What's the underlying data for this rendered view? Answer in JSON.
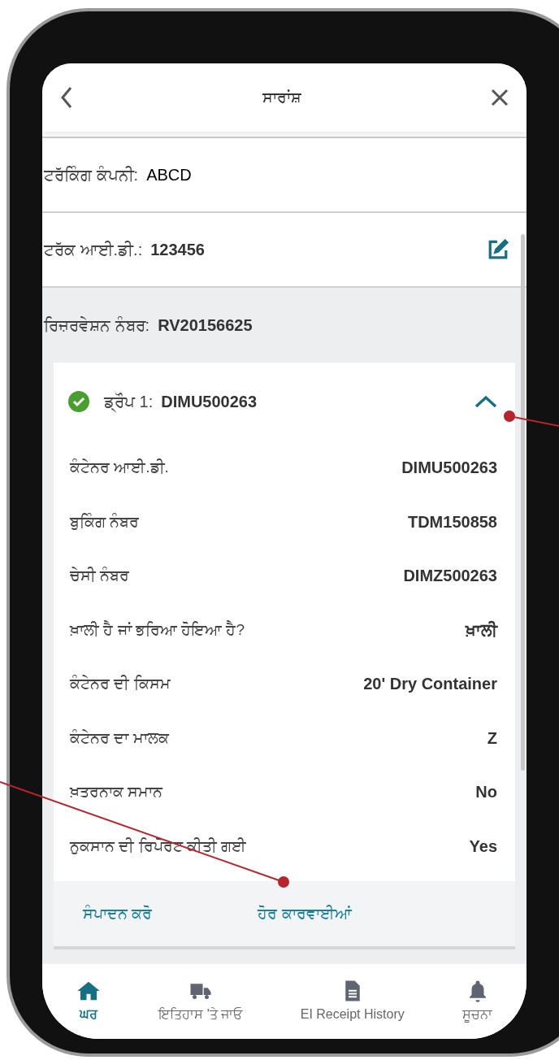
{
  "header": {
    "title": "ਸਾਰਾਂਸ਼"
  },
  "summary_rows": [
    {
      "label": "ਟਰੱਕਿੰਗ ਕੰਪਨੀ:",
      "value": "ABCD",
      "editable": false,
      "shaded": false
    },
    {
      "label": "ਟਰੱਕ ਆਈ.ਡੀ.:",
      "value": "123456",
      "editable": true,
      "shaded": false
    },
    {
      "label": "ਰਿਜ਼ਰਵੇਸ਼ਨ ਨੰਬਰ:",
      "value": "RV20156625",
      "editable": false,
      "shaded": true
    }
  ],
  "trip_card": {
    "label": "ਡ੍ਰੌਪ 1:",
    "value": "DIMU500263",
    "completed": true,
    "expanded": true,
    "details": [
      {
        "label": "ਕੰਟੇਨਰ ਆਈ.ਡੀ.",
        "value": "DIMU500263"
      },
      {
        "label": "ਬੁਕਿੰਗ ਨੰਬਰ",
        "value": "TDM150858"
      },
      {
        "label": "ਚੇਸੀ ਨੰਬਰ",
        "value": "DIMZ500263"
      },
      {
        "label": "ਖ਼ਾਲੀ ਹੈ ਜਾਂ ਭਰਿਆ ਹੋਇਆ ਹੈ?",
        "value": "ਖ਼ਾਲੀ"
      },
      {
        "label": "ਕੰਟੇਨਰ ਦੀ ਕਿਸਮ",
        "value": "20' Dry Container"
      },
      {
        "label": "ਕੰਟੇਨਰ ਦਾ ਮਾਲਕ",
        "value": "Z"
      },
      {
        "label": "ਖ਼ਤਰਨਾਕ ਸਮਾਨ",
        "value": "No"
      },
      {
        "label": "ਨੁਕਸਾਨ ਦੀ ਰਿਪੋਰਟ ਕੀਤੀ ਗਈ",
        "value": "Yes"
      }
    ],
    "actions": [
      "ਸੰਪਾਦਨ ਕਰੋ",
      "ਹੋਰ ਕਾਰਵਾਈਆਂ"
    ]
  },
  "bottom_nav": [
    {
      "kind": "home",
      "label": "ਘਰ",
      "selected": true
    },
    {
      "kind": "truck",
      "label": "ਇਤਿਹਾਸ 'ਤੇ ਜਾਓ",
      "selected": false
    },
    {
      "kind": "document",
      "label": "EI Receipt History",
      "selected": false
    },
    {
      "kind": "bell",
      "label": "ਸੂਚਨਾ",
      "selected": false
    }
  ]
}
